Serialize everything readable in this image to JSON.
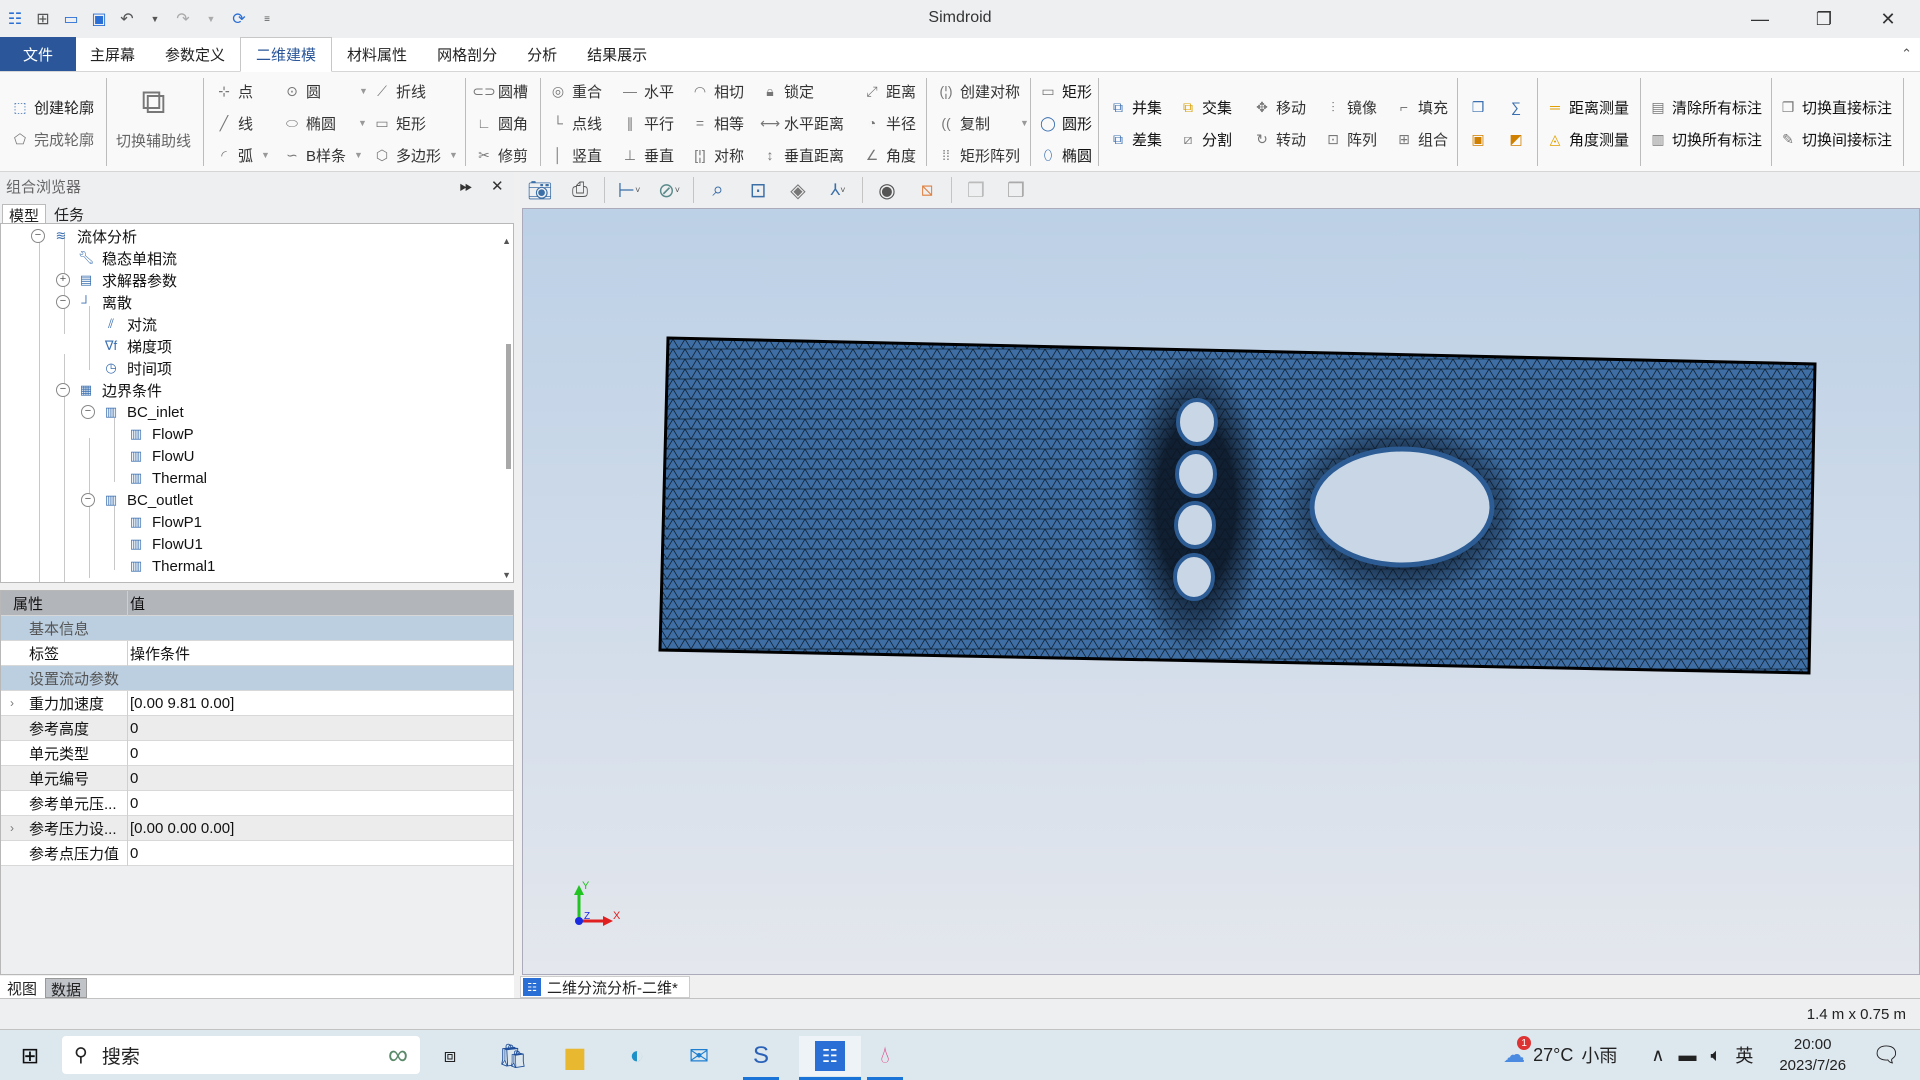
{
  "window": {
    "title": "Simdroid",
    "controls": {
      "minimize": "—",
      "restore": "❐",
      "close": "✕"
    }
  },
  "quick_access": [
    "app-logo",
    "new-icon",
    "open-icon",
    "save-icon",
    "undo-icon",
    "redo-icon",
    "refresh-icon",
    "customize-icon"
  ],
  "menu_tabs": [
    {
      "label": "文件",
      "type": "file"
    },
    {
      "label": "主屏幕"
    },
    {
      "label": "参数定义"
    },
    {
      "label": "二维建模",
      "active": true
    },
    {
      "label": "材料属性"
    },
    {
      "label": "网格剖分"
    },
    {
      "label": "分析"
    },
    {
      "label": "结果展示"
    }
  ],
  "ribbon": {
    "profile": {
      "create": "创建轮廓",
      "finish": "完成轮廓"
    },
    "aux": {
      "toggle": "切换辅助线"
    },
    "sketch": {
      "point": "点",
      "line": "线",
      "arc": "弧",
      "circle": "圆",
      "ellipse": "椭圆",
      "bspline": "B样条",
      "polyline": "折线",
      "rect": "矩形",
      "polygon": "多边形",
      "slot": "圆槽",
      "fillet": "圆角",
      "trim": "修剪"
    },
    "constraints": {
      "coincident": "重合",
      "pointline": "点线",
      "vertical": "竖直",
      "horizontal": "水平",
      "parallel": "平行",
      "perpendicular": "垂直",
      "tangent": "相切",
      "equal": "相等",
      "symmetric": "对称",
      "lock": "锁定",
      "hdist": "水平距离",
      "vdist": "垂直距离",
      "distance": "距离",
      "radius": "半径",
      "angle": "角度"
    },
    "transform": {
      "mirror_create": "创建对称",
      "copy": "复制",
      "rect_array": "矩形阵列"
    },
    "shapes": {
      "rect": "矩形",
      "circle": "圆形",
      "ellipse": "椭圆"
    },
    "boolean": {
      "union": "并集",
      "difference": "差集",
      "intersect": "交集",
      "split": "分割",
      "move": "移动",
      "rotate": "转动",
      "mirror": "镜像",
      "array": "阵列",
      "fill": "填充",
      "combine": "组合"
    },
    "measure": {
      "dist": "距离测量",
      "angle": "角度测量",
      "clear_all": "清除所有标注",
      "toggle_all": "切换所有标注",
      "toggle_direct": "切换直接标注",
      "toggle_indirect": "切换间接标注"
    }
  },
  "browser": {
    "title": "组合浏览器",
    "tabs": [
      {
        "label": "模型",
        "active": true
      },
      {
        "label": "任务"
      }
    ],
    "tree": [
      {
        "label": "流体分析",
        "level": 0,
        "toggle": "−",
        "icon": "waves-icon"
      },
      {
        "label": "稳态单相流",
        "level": 1,
        "icon": "wrench-icon"
      },
      {
        "label": "求解器参数",
        "level": 1,
        "toggle": "+",
        "icon": "solver-settings-icon"
      },
      {
        "label": "离散",
        "level": 1,
        "toggle": "−",
        "icon": "discrete-icon"
      },
      {
        "label": "对流",
        "level": 2,
        "icon": "convection-icon"
      },
      {
        "label": "梯度项",
        "level": 2,
        "icon": "gradient-icon"
      },
      {
        "label": "时间项",
        "level": 2,
        "icon": "clock-icon"
      },
      {
        "label": "边界条件",
        "level": 1,
        "toggle": "−",
        "icon": "boundary-icon"
      },
      {
        "label": "BC_inlet",
        "level": 2,
        "toggle": "−",
        "icon": "bc-icon"
      },
      {
        "label": "FlowP",
        "level": 3,
        "icon": "bc-icon"
      },
      {
        "label": "FlowU",
        "level": 3,
        "icon": "bc-icon"
      },
      {
        "label": "Thermal",
        "level": 3,
        "icon": "bc-icon"
      },
      {
        "label": "BC_outlet",
        "level": 2,
        "toggle": "−",
        "icon": "bc-icon"
      },
      {
        "label": "FlowP1",
        "level": 3,
        "icon": "bc-icon"
      },
      {
        "label": "FlowU1",
        "level": 3,
        "icon": "bc-icon"
      },
      {
        "label": "Thermal1",
        "level": 3,
        "icon": "bc-icon"
      }
    ]
  },
  "properties": {
    "headers": {
      "key": "属性",
      "value": "值"
    },
    "rows": [
      {
        "type": "group",
        "key": "基本信息"
      },
      {
        "type": "item",
        "key": "标签",
        "value": "操作条件"
      },
      {
        "type": "group",
        "key": "设置流动参数"
      },
      {
        "type": "item",
        "key": "重力加速度",
        "value": "[0.00 9.81 0.00]",
        "expandable": true
      },
      {
        "type": "item",
        "key": "参考高度",
        "value": "0"
      },
      {
        "type": "item",
        "key": "单元类型",
        "value": "0"
      },
      {
        "type": "item",
        "key": "单元编号",
        "value": "0"
      },
      {
        "type": "item",
        "key": "参考单元压...",
        "value": "0"
      },
      {
        "type": "item",
        "key": "参考压力设...",
        "value": "[0.00 0.00 0.00]",
        "expandable": true
      },
      {
        "type": "item",
        "key": "参考点压力值",
        "value": "0"
      }
    ]
  },
  "bottom_tabs": [
    {
      "label": "视图"
    },
    {
      "label": "数据",
      "active": true
    }
  ],
  "view_toolbar": [
    "camera-icon",
    "print-icon",
    "snap-icon",
    "display-mode-icon",
    "zoom-box-icon",
    "fit-all-icon",
    "iso-view-icon",
    "axis-view-icon",
    "visibility-icon",
    "section-icon",
    "light-icon",
    "light2-icon"
  ],
  "viewport": {
    "axis": {
      "x": "X",
      "y": "Y",
      "z": "Z"
    },
    "mesh_color": "#3e6ea3",
    "document_tab": "二维分流分析-二维*"
  },
  "status": {
    "dimensions": "1.4 m x 0.75 m"
  },
  "taskbar": {
    "search_placeholder": "搜索",
    "weather": {
      "temp": "27°C",
      "desc": "小雨",
      "badge": "1"
    },
    "ime": "英",
    "time": "20:00",
    "date": "2023/7/26"
  }
}
